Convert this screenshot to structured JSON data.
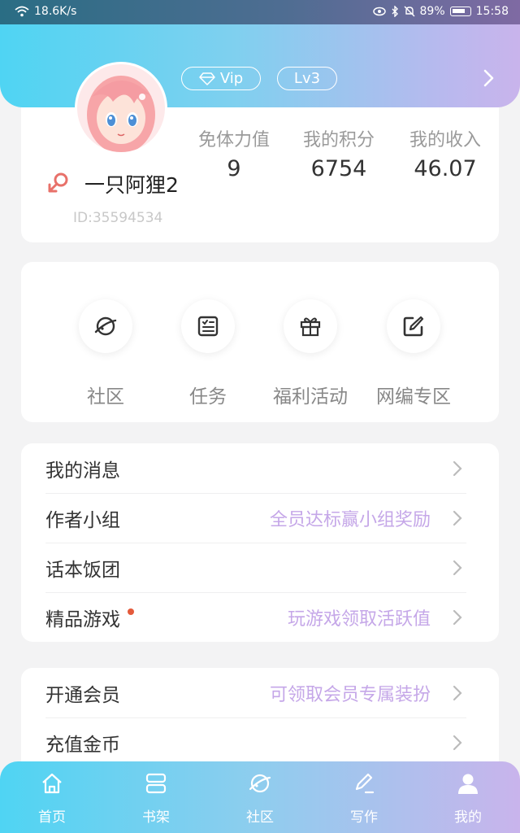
{
  "status_bar": {
    "network_speed": "18.6K/s",
    "battery": "89%",
    "time": "15:58"
  },
  "header": {
    "vip_label": "Vip",
    "level_label": "Lv3"
  },
  "profile": {
    "username": "一只阿狸2",
    "user_id": "ID:35594534",
    "stats": [
      {
        "label": "免体力值",
        "value": "9"
      },
      {
        "label": "我的积分",
        "value": "6754"
      },
      {
        "label": "我的收入",
        "value": "46.07"
      }
    ]
  },
  "shortcuts": [
    {
      "label": "社区",
      "icon": "planet-icon"
    },
    {
      "label": "任务",
      "icon": "task-list-icon"
    },
    {
      "label": "福利活动",
      "icon": "gift-icon"
    },
    {
      "label": "网编专区",
      "icon": "edit-square-icon"
    }
  ],
  "menu_group_1": [
    {
      "title": "我的消息",
      "hint": ""
    },
    {
      "title": "作者小组",
      "hint": "全员达标赢小组奖励"
    },
    {
      "title": "话本饭团",
      "hint": ""
    },
    {
      "title": "精品游戏",
      "hint": "玩游戏领取活跃值"
    }
  ],
  "menu_group_2": [
    {
      "title": "开通会员",
      "hint": "可领取会员专属装扮"
    },
    {
      "title": "充值金币",
      "hint": ""
    }
  ],
  "tabbar": [
    {
      "label": "首页",
      "icon": "home-icon"
    },
    {
      "label": "书架",
      "icon": "bookshelf-icon"
    },
    {
      "label": "社区",
      "icon": "planet-icon"
    },
    {
      "label": "写作",
      "icon": "pen-icon"
    },
    {
      "label": "我的",
      "icon": "user-icon"
    }
  ],
  "colors": {
    "gradient_start": "#4fd4f3",
    "gradient_end": "#c9b4ec",
    "hint_purple": "#c5a7e8",
    "gender_red": "#e8716a"
  }
}
